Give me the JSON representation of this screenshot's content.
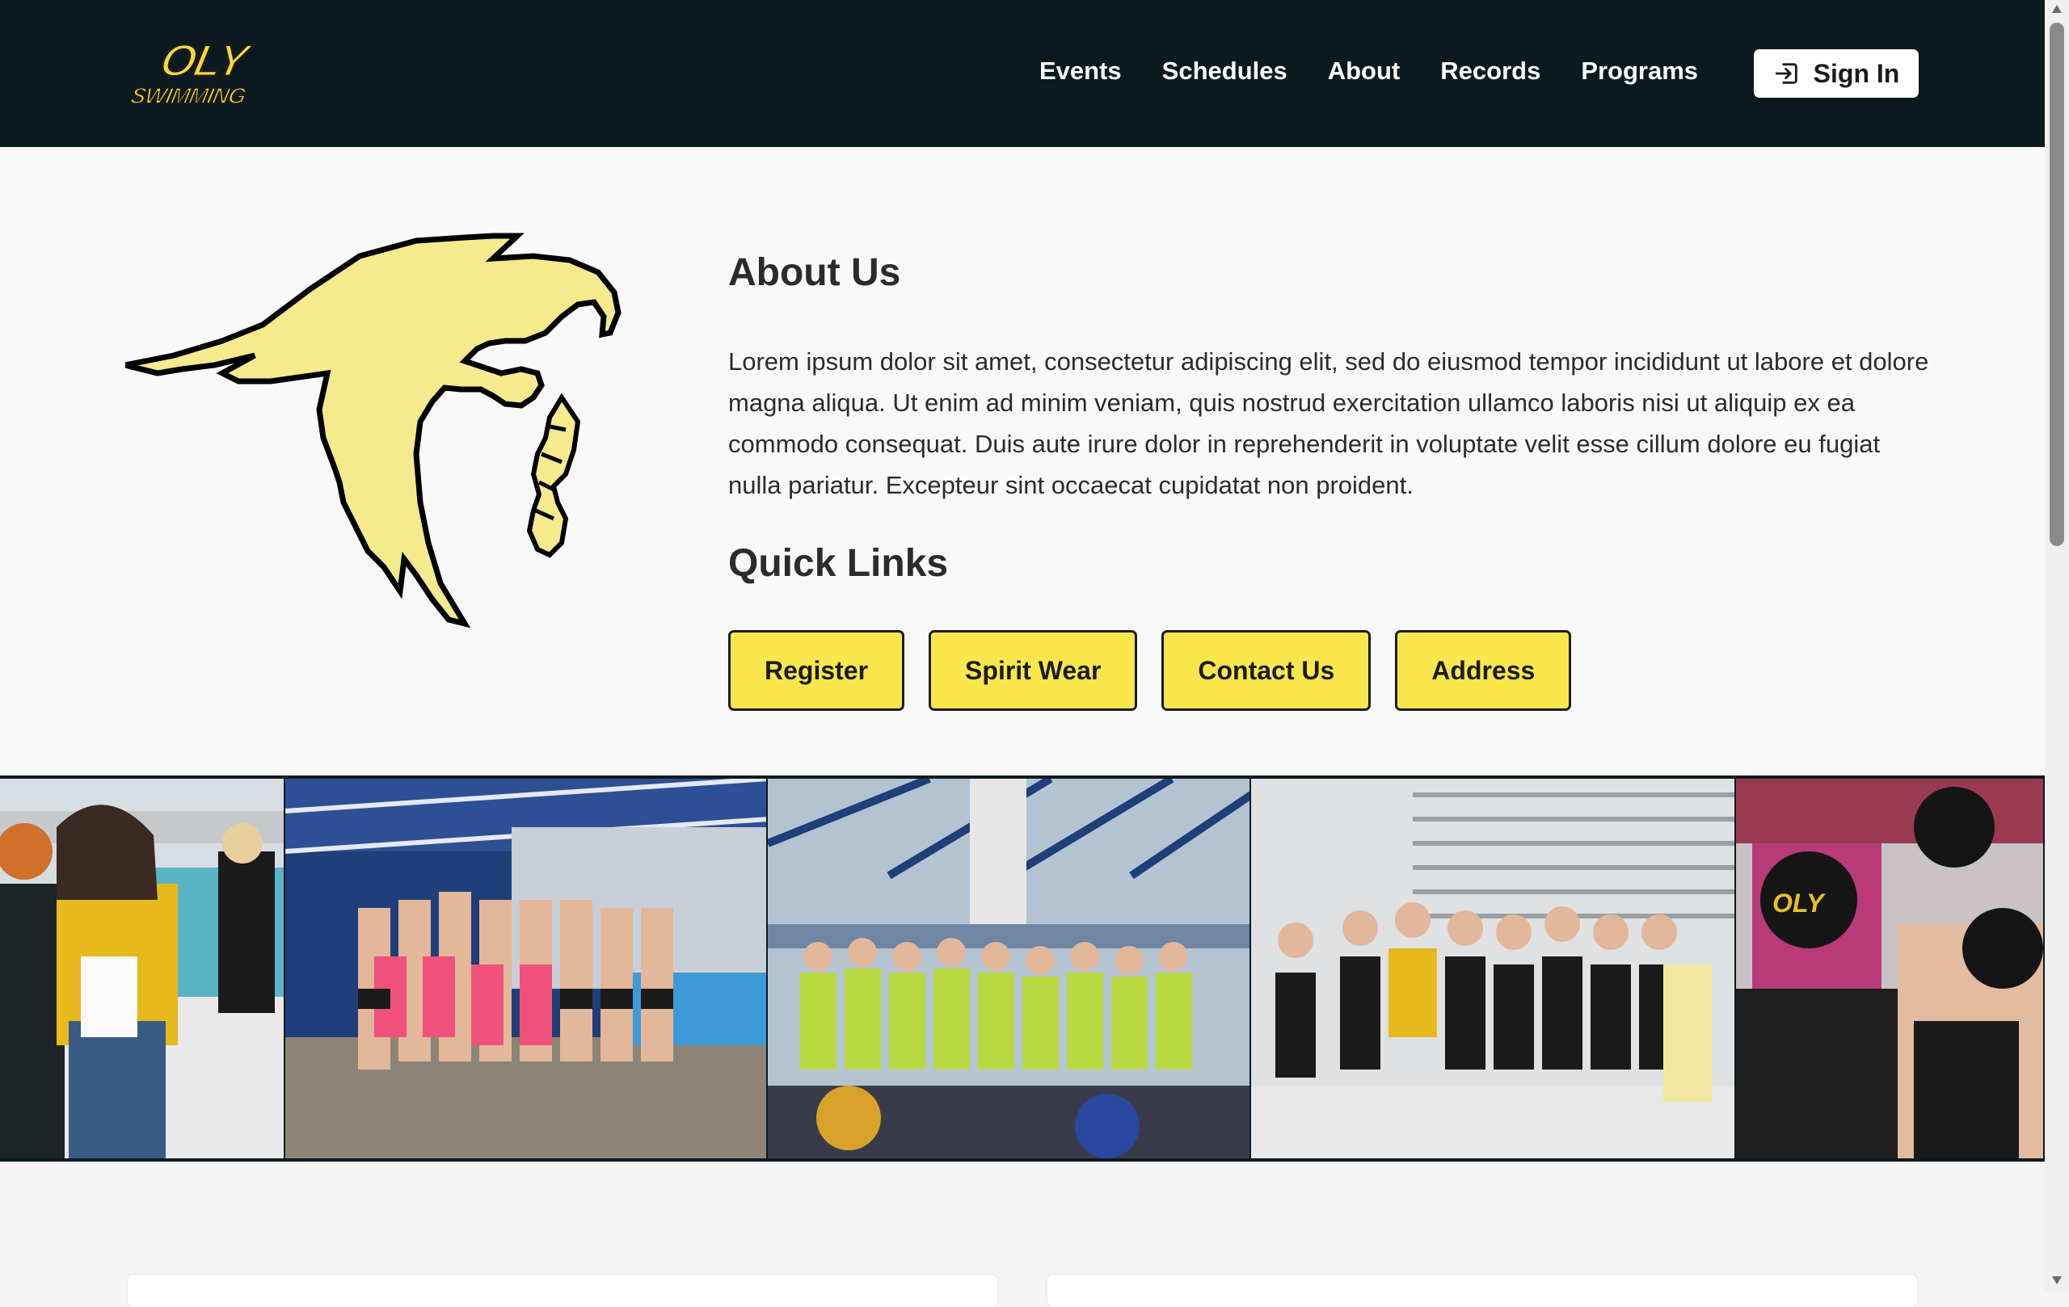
{
  "header": {
    "logo": {
      "text_top": "OLY",
      "text_bottom": "SWIMMING",
      "icon": "oly-swimming-logo"
    },
    "nav": [
      {
        "label": "Events"
      },
      {
        "label": "Schedules"
      },
      {
        "label": "About"
      },
      {
        "label": "Records"
      },
      {
        "label": "Programs"
      }
    ],
    "sign_in": {
      "label": "Sign In",
      "icon": "login-icon"
    }
  },
  "about": {
    "title": "About Us",
    "text": "Lorem ipsum dolor sit amet, consectetur adipiscing elit, sed do eiusmod tempor incididunt ut labore et dolore magna aliqua. Ut enim ad minim veniam, quis nostrud exercitation ullamco laboris nisi ut aliquip ex ea commodo consequat. Duis aute irure dolor in reprehenderit in voluptate velit esse cillum dolore eu fugiat nulla pariatur. Excepteur sint occaecat cupidatat non proident.",
    "mascot_icon": "eagle-mascot"
  },
  "quick_links": {
    "title": "Quick Links",
    "buttons": [
      {
        "label": "Register"
      },
      {
        "label": "Spirit Wear"
      },
      {
        "label": "Contact Us"
      },
      {
        "label": "Address"
      }
    ]
  },
  "photo_strip": {
    "photos": [
      {
        "name": "team-photo-1"
      },
      {
        "name": "team-photo-2"
      },
      {
        "name": "team-photo-3"
      },
      {
        "name": "team-photo-4"
      },
      {
        "name": "team-photo-5"
      }
    ]
  },
  "colors": {
    "header_bg": "#0b1a1f",
    "accent_yellow": "#fae74d",
    "mascot_fill": "#f6ea8f",
    "page_bg": "#f9f9f9"
  }
}
